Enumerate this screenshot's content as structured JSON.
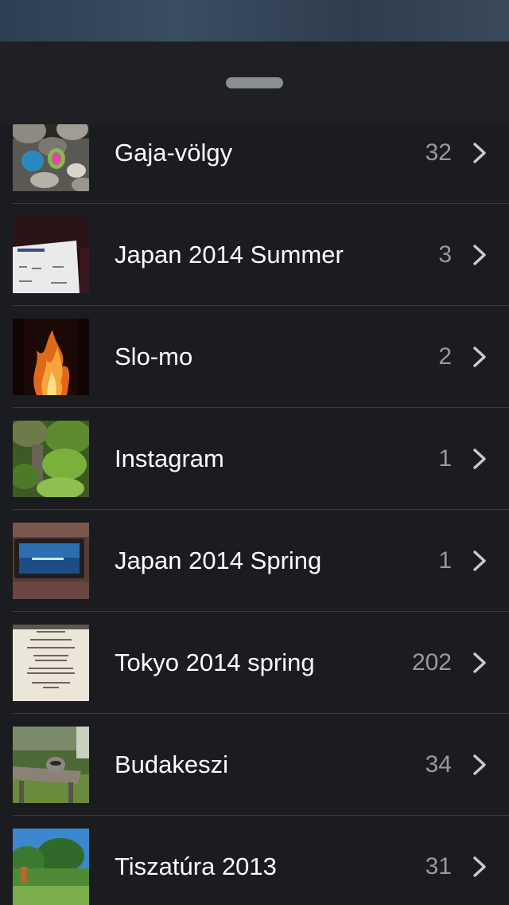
{
  "sheet": {
    "handle_icon": "grabber-handle"
  },
  "albums": [
    {
      "title": "Gaja-völgy",
      "count": "32",
      "thumb_icon": "photo-thumbnail-rocks-bags"
    },
    {
      "title": "Japan 2014 Summer",
      "count": "3",
      "thumb_icon": "photo-thumbnail-boarding-pass"
    },
    {
      "title": "Slo-mo",
      "count": "2",
      "thumb_icon": "photo-thumbnail-fire"
    },
    {
      "title": "Instagram",
      "count": "1",
      "thumb_icon": "photo-thumbnail-greenery"
    },
    {
      "title": "Japan 2014 Spring",
      "count": "1",
      "thumb_icon": "photo-thumbnail-inflight-screen"
    },
    {
      "title": "Tokyo 2014 spring",
      "count": "202",
      "thumb_icon": "photo-thumbnail-menu-card"
    },
    {
      "title": "Budakeszi",
      "count": "34",
      "thumb_icon": "photo-thumbnail-raccoon"
    },
    {
      "title": "Tiszatúra 2013",
      "count": "31",
      "thumb_icon": "photo-thumbnail-riverside"
    }
  ],
  "colors": {
    "background": "#1a1c1f",
    "title_text": "#ffffff",
    "count_text": "#96999e",
    "separator": "#36393e"
  }
}
